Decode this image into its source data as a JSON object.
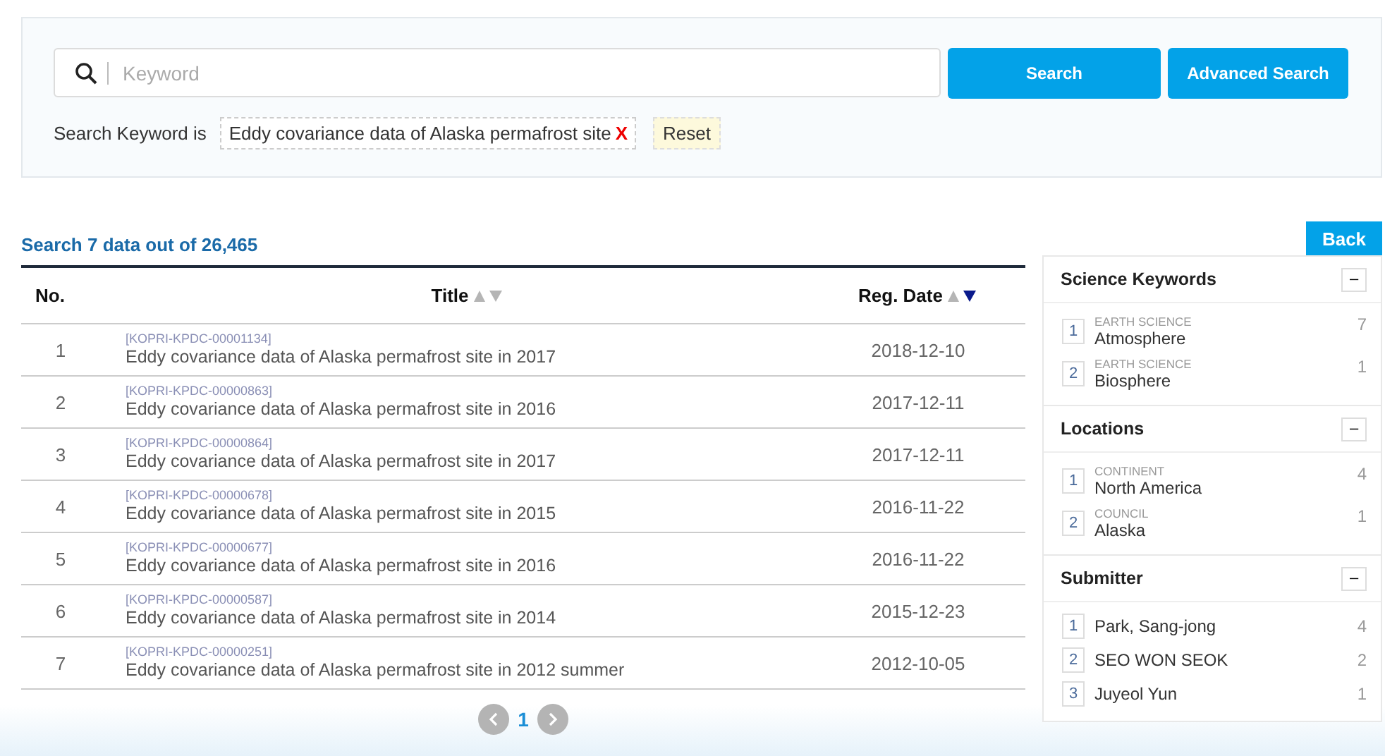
{
  "search": {
    "placeholder": "Keyword",
    "buttons": [
      "Search",
      "Advanced Search"
    ],
    "keyword_label": "Search Keyword is",
    "keyword": "Eddy covariance data of Alaska permafrost site",
    "remove": "X",
    "reset": "Reset"
  },
  "results": {
    "summary": "Search 7 data out of 26,465",
    "back": "Back",
    "columns": [
      {
        "label": "No.",
        "sortable": false
      },
      {
        "label": "Title",
        "sortable": true,
        "sorted_desc": false
      },
      {
        "label": "Reg. Date",
        "sortable": true,
        "sorted_desc": true
      }
    ],
    "rows": [
      {
        "no": "1",
        "id": "[KOPRI-KPDC-00001134]",
        "title": "Eddy covariance data of Alaska permafrost site in 2017",
        "date": "2018-12-10"
      },
      {
        "no": "2",
        "id": "[KOPRI-KPDC-00000863]",
        "title": "Eddy covariance data of Alaska permafrost site in 2016",
        "date": "2017-12-11"
      },
      {
        "no": "3",
        "id": "[KOPRI-KPDC-00000864]",
        "title": "Eddy covariance data of Alaska permafrost site in 2017",
        "date": "2017-12-11"
      },
      {
        "no": "4",
        "id": "[KOPRI-KPDC-00000678]",
        "title": "Eddy covariance data of Alaska permafrost site in 2015",
        "date": "2016-11-22"
      },
      {
        "no": "5",
        "id": "[KOPRI-KPDC-00000677]",
        "title": "Eddy covariance data of Alaska permafrost site in 2016",
        "date": "2016-11-22"
      },
      {
        "no": "6",
        "id": "[KOPRI-KPDC-00000587]",
        "title": "Eddy covariance data of Alaska permafrost site in 2014",
        "date": "2015-12-23"
      },
      {
        "no": "7",
        "id": "[KOPRI-KPDC-00000251]",
        "title": "Eddy covariance data of Alaska permafrost site in 2012 summer",
        "date": "2012-10-05"
      }
    ],
    "pages": [
      {
        "label": "1",
        "selected": true
      }
    ]
  },
  "facets": [
    {
      "title": "Science Keywords",
      "toggle": "–",
      "items": [
        {
          "rank": "1",
          "category": "EARTH SCIENCE",
          "name": "Atmosphere",
          "count": "7"
        },
        {
          "rank": "2",
          "category": "EARTH SCIENCE",
          "name": "Biosphere",
          "count": "1"
        }
      ]
    },
    {
      "title": "Locations",
      "toggle": "–",
      "items": [
        {
          "rank": "1",
          "category": "CONTINENT",
          "name": "North America",
          "count": "4"
        },
        {
          "rank": "2",
          "category": "COUNCIL",
          "name": "Alaska",
          "count": "1"
        }
      ]
    },
    {
      "title": "Submitter",
      "toggle": "–",
      "items": [
        {
          "rank": "1",
          "name": "Park, Sang-jong",
          "count": "4"
        },
        {
          "rank": "2",
          "name": "SEO WON SEOK",
          "count": "2"
        },
        {
          "rank": "3",
          "name": "Juyeol Yun",
          "count": "1"
        }
      ]
    }
  ]
}
